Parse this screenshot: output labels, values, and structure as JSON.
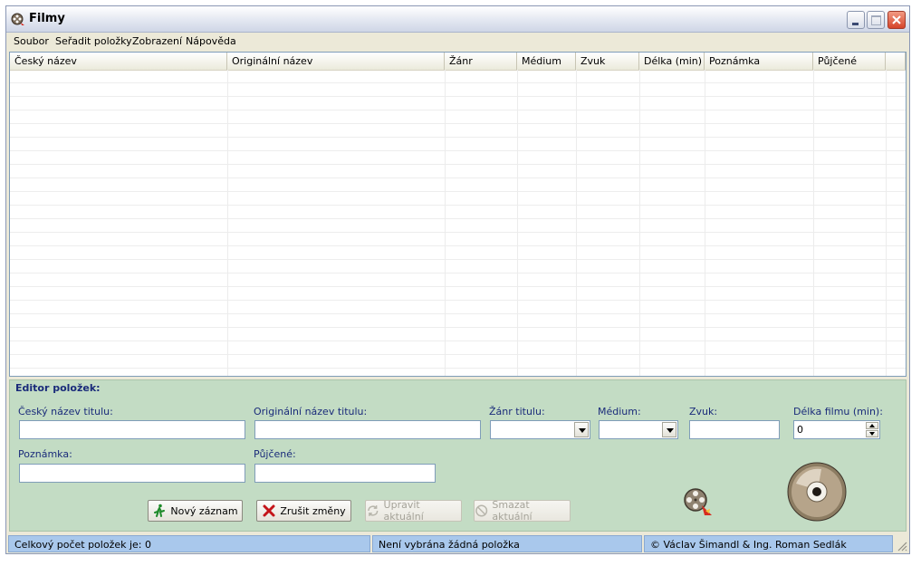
{
  "window": {
    "title": "Filmy"
  },
  "menu": [
    {
      "label": "Soubor"
    },
    {
      "label": "Seřadit položky"
    },
    {
      "label": "Zobrazení"
    },
    {
      "label": "Nápověda"
    }
  ],
  "list": {
    "columns": [
      "Český název",
      "Originální název",
      "Žánr",
      "Médium",
      "Zvuk",
      "Délka (min)",
      "Poznámka",
      "Půjčené"
    ],
    "rows": []
  },
  "editor": {
    "title": "Editor položek:",
    "labels": {
      "cesky": "Český název titulu:",
      "originalni": "Originální název titulu:",
      "zanr": "Žánr titulu:",
      "medium": "Médium:",
      "zvuk": "Zvuk:",
      "delka": "Délka filmu (min):",
      "poznamka": "Poznámka:",
      "pujcene": "Půjčené:"
    },
    "values": {
      "cesky": "",
      "originalni": "",
      "zanr": "",
      "medium": "",
      "zvuk": "",
      "delka": "0",
      "poznamka": "",
      "pujcene": ""
    },
    "buttons": {
      "new": "Nový záznam",
      "cancel": "Zrušit změny",
      "update": "Upravit aktuální",
      "delete": "Smazat aktuální"
    }
  },
  "status": {
    "count": "Celkový počet položek je: 0",
    "selection": "Není vybrána žádná položka",
    "copyright": "© Václav Šimandl & Ing. Roman Sedlák"
  },
  "colors": {
    "editor_bg": "#c3dcc4",
    "label_text": "#1a2b7a",
    "status_bg": "#a9c8ec"
  }
}
